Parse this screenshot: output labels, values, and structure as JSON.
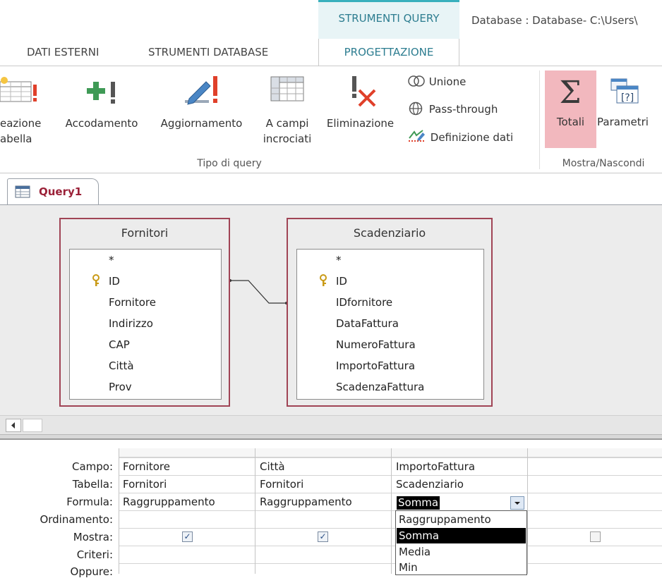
{
  "window": {
    "title": "Database : Database- C:\\Users\\"
  },
  "ribbon": {
    "contextual_group": "STRUMENTI QUERY",
    "tabs": [
      "DATI ESTERNI",
      "STRUMENTI DATABASE",
      "PROGETTAZIONE"
    ],
    "active_tab": "PROGETTAZIONE",
    "query_type_buttons": [
      {
        "label": "eazione",
        "label2": "abella",
        "icon": "make-table-icon"
      },
      {
        "label": "Accodamento",
        "icon": "append-icon"
      },
      {
        "label": "Aggiornamento",
        "icon": "update-icon"
      },
      {
        "label": "A campi",
        "label2": "incrociati",
        "icon": "crosstab-icon"
      },
      {
        "label": "Eliminazione",
        "icon": "delete-icon"
      }
    ],
    "small_buttons": [
      {
        "label": "Unione",
        "icon": "union-icon"
      },
      {
        "label": "Pass-through",
        "icon": "globe-icon"
      },
      {
        "label": "Definizione dati",
        "icon": "data-definition-icon"
      }
    ],
    "group_query_type": "Tipo di query",
    "show_hide_buttons": [
      {
        "label": "Totali",
        "icon": "sigma-icon",
        "active": true
      },
      {
        "label": "Parametri",
        "icon": "parameters-icon"
      }
    ],
    "group_show_hide": "Mostra/Nascondi",
    "colors": {
      "accent": "#2d7d90",
      "active_button": "#f2b8be"
    }
  },
  "document": {
    "tab_label": "Query1",
    "tab_icon": "query-icon"
  },
  "tables": [
    {
      "name": "Fornitori",
      "fields": [
        "*",
        "ID",
        "Fornitore",
        "Indirizzo",
        "CAP",
        "Città",
        "Prov"
      ],
      "key_field": "ID"
    },
    {
      "name": "Scadenziario",
      "fields": [
        "*",
        "ID",
        "IDfornitore",
        "DataFattura",
        "NumeroFattura",
        "ImportoFattura",
        "ScadenzaFattura"
      ],
      "key_field": "ID"
    }
  ],
  "grid": {
    "row_labels": [
      "Campo:",
      "Tabella:",
      "Formula:",
      "Ordinamento:",
      "Mostra:",
      "Criteri:",
      "Oppure:"
    ],
    "columns": [
      {
        "campo": "Fornitore",
        "tabella": "Fornitori",
        "formula": "Raggruppamento",
        "mostra": true
      },
      {
        "campo": "Città",
        "tabella": "Fornitori",
        "formula": "Raggruppamento",
        "mostra": true
      },
      {
        "campo": "ImportoFattura",
        "tabella": "Scadenziario",
        "formula": "Somma",
        "mostra": true
      },
      {
        "campo": "",
        "tabella": "",
        "formula": "",
        "mostra": false
      }
    ],
    "dropdown_options": [
      "Raggruppamento",
      "Somma",
      "Media",
      "Min"
    ],
    "dropdown_selected": "Somma"
  }
}
